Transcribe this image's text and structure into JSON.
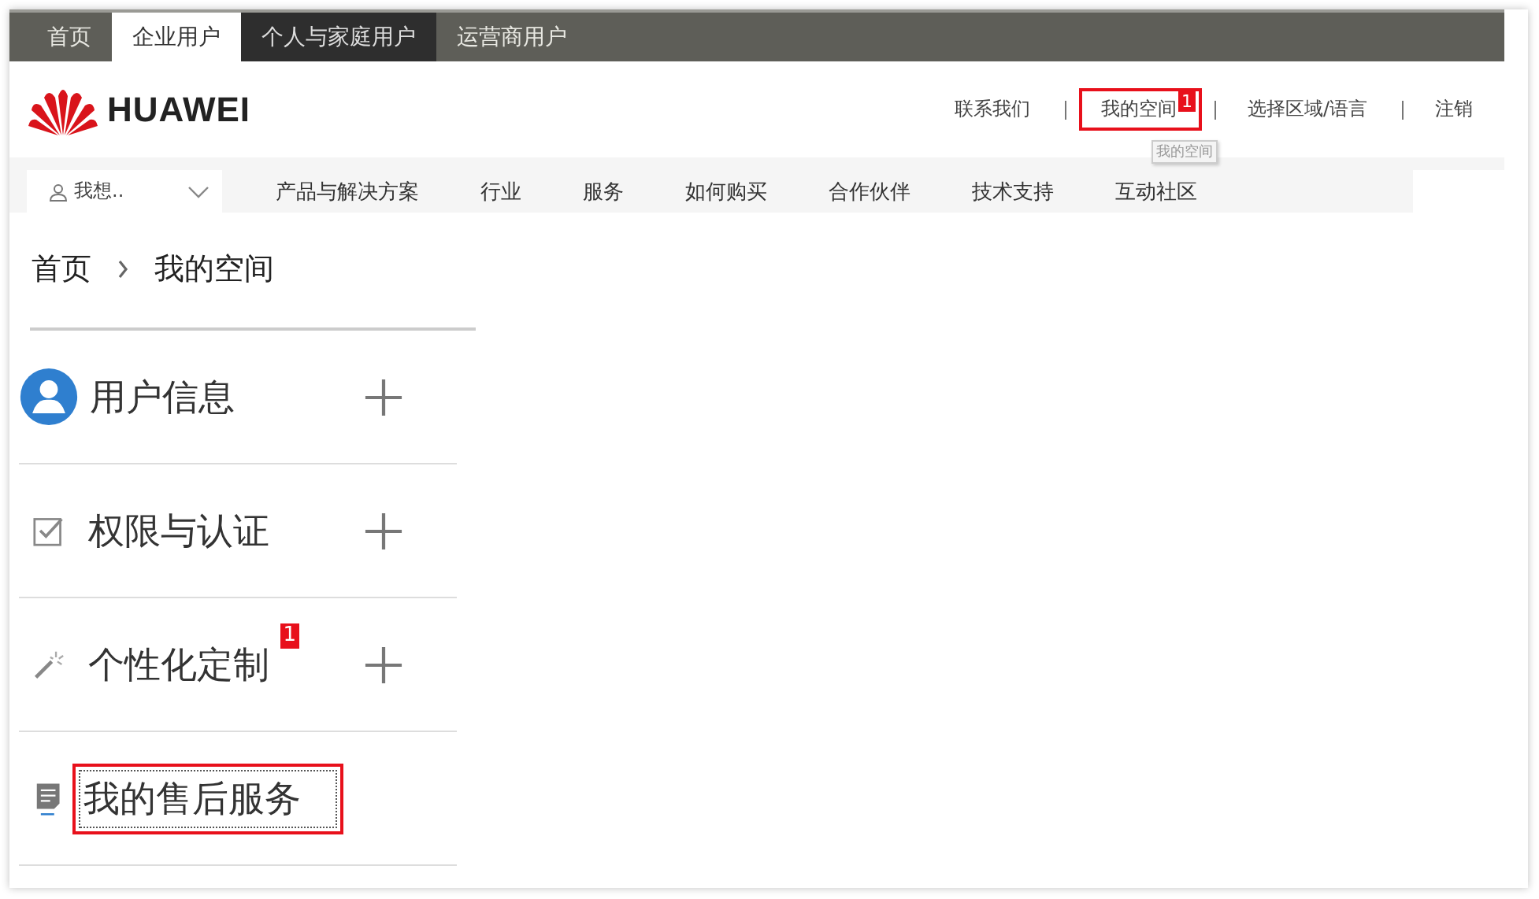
{
  "top_tabs": [
    {
      "label": "首页",
      "selected": false,
      "hovered": false
    },
    {
      "label": "企业用户",
      "selected": true,
      "hovered": false
    },
    {
      "label": "个人与家庭用户",
      "selected": false,
      "hovered": true
    },
    {
      "label": "运营商用户",
      "selected": false,
      "hovered": false
    }
  ],
  "logo": {
    "text": "HUAWEI"
  },
  "header_links": [
    {
      "label": "联系我们",
      "highlighted": false
    },
    {
      "label": "我的空间",
      "highlighted": true,
      "badge": "1",
      "tooltip": "我的空间"
    },
    {
      "label": "选择区域/语言",
      "highlighted": false
    },
    {
      "label": "注销",
      "highlighted": false
    }
  ],
  "nav": {
    "dropdown": "我想..",
    "items": [
      "产品与解决方案",
      "行业",
      "服务",
      "如何购买",
      "合作伙伴",
      "技术支持",
      "互动社区"
    ]
  },
  "breadcrumb": [
    "首页",
    "我的空间"
  ],
  "sidebar": {
    "items": [
      {
        "label": "用户信息",
        "kind": "user",
        "expandable": true,
        "highlighted": false
      },
      {
        "label": "权限与认证",
        "kind": "check",
        "expandable": true,
        "highlighted": false
      },
      {
        "label": "个性化定制",
        "kind": "wand",
        "expandable": true,
        "highlighted": false,
        "badge": "1"
      },
      {
        "label": "我的售后服务",
        "kind": "note",
        "expandable": false,
        "highlighted": true
      }
    ]
  }
}
